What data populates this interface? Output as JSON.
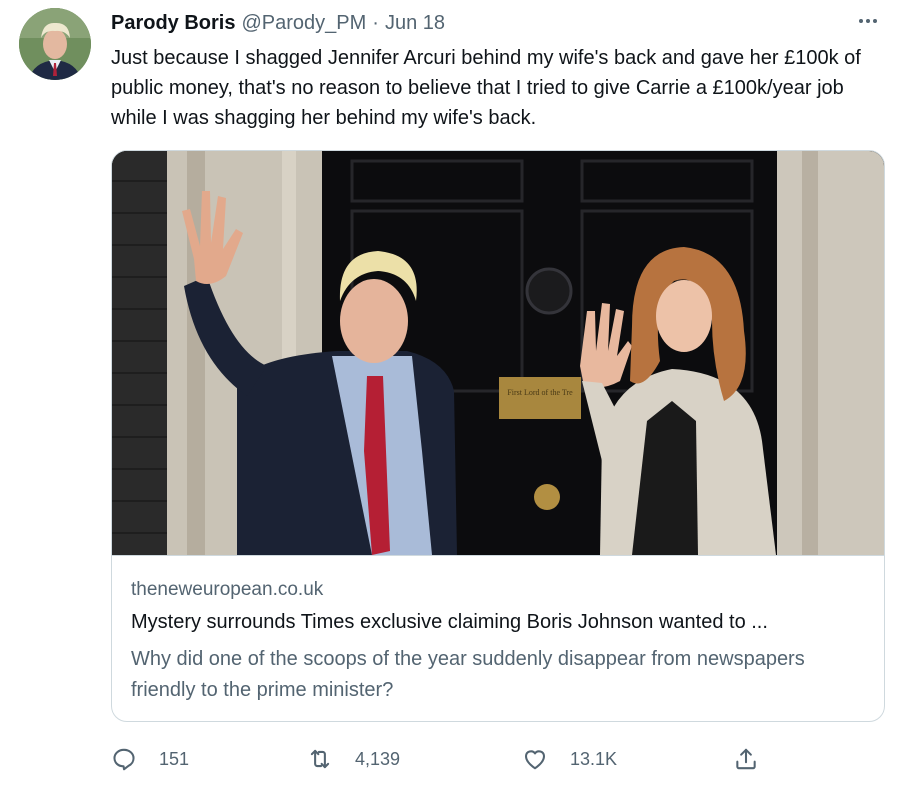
{
  "tweet": {
    "display_name": "Parody Boris",
    "handle": "@Parody_PM",
    "separator": "·",
    "date": "Jun 18",
    "text": "Just because I shagged Jennifer Arcuri behind my wife's back and gave her £100k of public money, that's no reason to believe that I tried to give Carrie a £100k/year job while I was shagging her behind my wife's back."
  },
  "icons": {
    "more": "more-horizontal-icon",
    "reply": "speech-bubble-icon",
    "retweet": "retweet-icon",
    "like": "heart-icon",
    "share": "share-upload-icon"
  },
  "card": {
    "domain": "theneweuropean.co.uk",
    "title": "Mystery surrounds Times exclusive claiming Boris Johnson wanted to ...",
    "description": "Why did one of the scoops of the year suddenly disappear from newspapers friendly to the prime minister?",
    "image_plaque_text": "First Lord of the Tre"
  },
  "metrics": {
    "replies": "151",
    "retweets": "4,139",
    "likes": "13.1K"
  },
  "colors": {
    "text_primary": "#0f1419",
    "text_secondary": "#536471",
    "border": "#cfd9de"
  }
}
